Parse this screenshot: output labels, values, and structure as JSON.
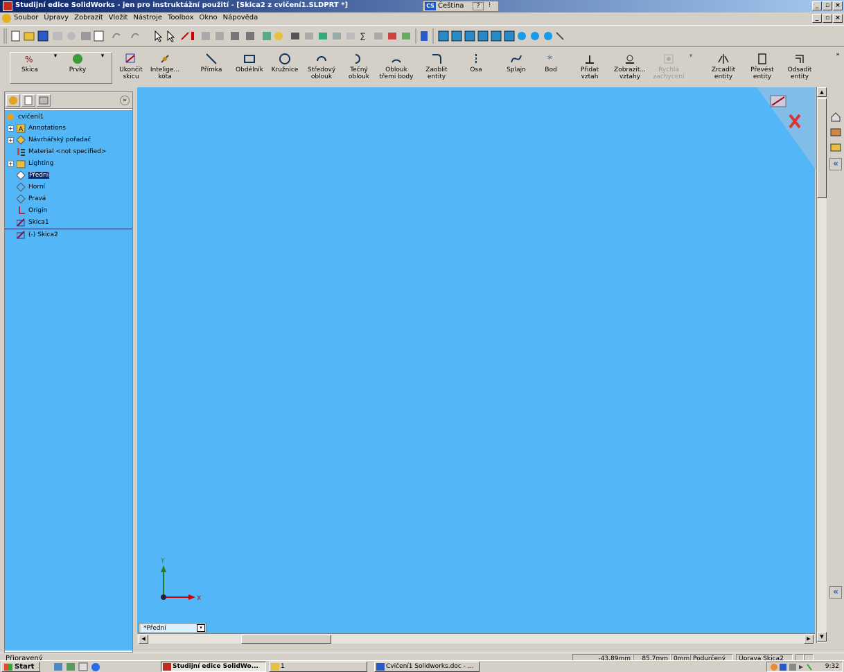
{
  "window": {
    "title": "Studijní edice SolidWorks - jen pro instruktážní použití - [Skica2 z cvičení1.SLDPRT *]",
    "language_code": "CS",
    "language_label": "Čeština",
    "help_glyph": "?",
    "options_glyph": "⁝",
    "min_glyph": "_",
    "max_glyph": "▫",
    "close_glyph": "×"
  },
  "menu": {
    "items": [
      "Soubor",
      "Úpravy",
      "Zobrazit",
      "Vložit",
      "Nástroje",
      "Toolbox",
      "Okno",
      "Nápověda"
    ]
  },
  "commands": {
    "skica": "Skica",
    "prvky": "Prvky",
    "ukoncit1": "Ukončit",
    "ukoncit2": "skicu",
    "inteligentni1": "Intelige...",
    "inteligentni2": "kóta",
    "primka": "Přímka",
    "obdelnik": "Obdélník",
    "kruznice": "Kružnice",
    "stredovy1": "Středový",
    "stredovy2": "oblouk",
    "tecny1": "Tečný",
    "tecny2": "oblouk",
    "oblouk3_1": "Oblouk",
    "oblouk3_2": "třemi body",
    "zaoblit1": "Zaoblit",
    "zaoblit2": "entity",
    "osa": "Osa",
    "splajn": "Splajn",
    "bod": "Bod",
    "pridat1": "Přidat",
    "pridat2": "vztah",
    "zobrazit1": "Zobrazit...",
    "zobrazit2": "vztahy",
    "rychla1": "Rychlá",
    "rychla2": "zachycení",
    "zrcadlit1": "Zrcadlit",
    "zrcadlit2": "entity",
    "prevest1": "Převést",
    "prevest2": "entity",
    "odsadit1": "Odsadit",
    "odsadit2": "entity",
    "more": "»"
  },
  "feature_tree": {
    "collapse": "»",
    "root": "cvičení1",
    "items": [
      "Annotations",
      "Návrhářský pořadač",
      "Material <not specified>",
      "Lighting",
      "Přední",
      "Horní",
      "Pravá",
      "Origin",
      "Skica1",
      "(-) Skica2"
    ]
  },
  "graphics": {
    "background": "#52b6f7",
    "view_label": "*Přední",
    "axis_x": "X",
    "axis_y": "Y"
  },
  "taskpane": {
    "expand": "«"
  },
  "status": {
    "ready": "Připravený",
    "x": "-43.89mm",
    "y": "85.7mm",
    "z": "0mm",
    "state": "Podurčený",
    "mode": "Úprava Skica2"
  },
  "taskbar": {
    "start": "Start",
    "task1": "Studijní edice SolidWo...",
    "task2": "1",
    "task3": "Cvičení1 Solidworks.doc - ...",
    "clock": "9:32"
  }
}
